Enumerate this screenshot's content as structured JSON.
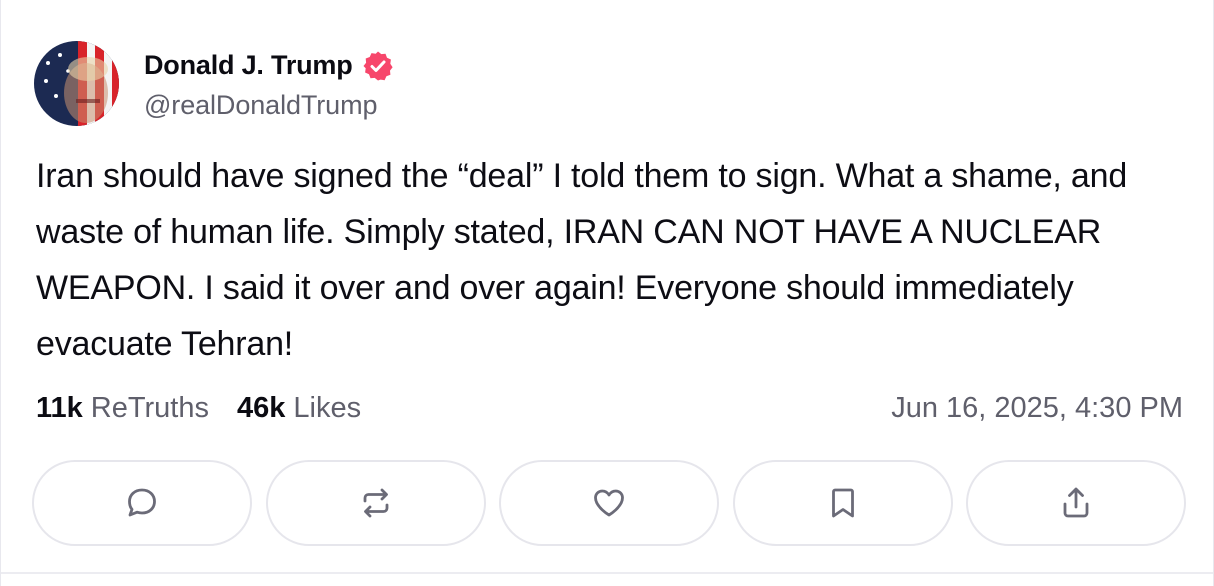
{
  "author": {
    "display_name": "Donald J. Trump",
    "handle": "@realDonaldTrump",
    "verified_icon": "verified-badge-icon",
    "verified_color": "#f7466b"
  },
  "post": {
    "text": "Iran should have signed the “deal” I told them to sign. What a shame, and waste of human life. Simply stated, IRAN CAN NOT HAVE A NUCLEAR WEAPON. I said it over and over again! Everyone should immediately evacuate Tehran!"
  },
  "stats": {
    "retruths_count": "11k",
    "retruths_label": "ReTruths",
    "likes_count": "46k",
    "likes_label": "Likes",
    "timestamp": "Jun 16, 2025, 4:30 PM"
  },
  "actions": [
    {
      "icon": "comment-icon"
    },
    {
      "icon": "retruth-icon"
    },
    {
      "icon": "heart-icon"
    },
    {
      "icon": "bookmark-icon"
    },
    {
      "icon": "share-icon"
    }
  ],
  "colors": {
    "text_primary": "#0b0b12",
    "text_secondary": "#5f5f6b",
    "icon_stroke": "#6b6b78",
    "button_border": "#e6e6ec"
  }
}
